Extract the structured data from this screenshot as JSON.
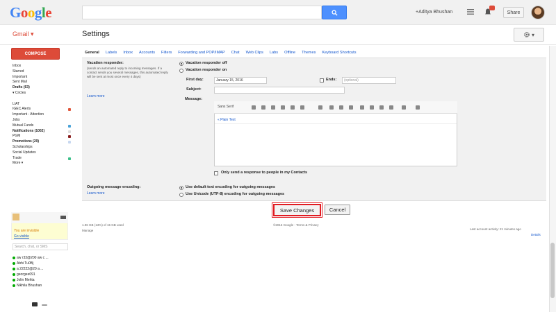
{
  "colors": {
    "brand_red": "#dd4b39",
    "link_blue": "#1155cc",
    "search_blue": "#4d90fe",
    "highlight_red": "#e11b22",
    "logo_blue": "#4285f4",
    "logo_red": "#ea4335",
    "logo_yellow": "#fbbc05",
    "logo_green": "#34a853"
  },
  "header": {
    "logo_letters": [
      "G",
      "o",
      "o",
      "g",
      "l",
      "e"
    ],
    "search_placeholder": "",
    "user_name": "+Aditya Bhushan",
    "share_label": "Share"
  },
  "subheader": {
    "app_label": "Gmail ▾",
    "page_title": "Settings"
  },
  "sidebar": {
    "compose_label": "COMPOSE",
    "items": [
      {
        "label": "Inbox",
        "bold": false
      },
      {
        "label": "Starred",
        "bold": false
      },
      {
        "label": "Important",
        "bold": false
      },
      {
        "label": "Sent Mail",
        "bold": false
      },
      {
        "label": "Drafts (63)",
        "bold": true
      },
      {
        "label": "▾ Circles",
        "bold": false
      },
      {
        "label": "",
        "bold": false
      },
      {
        "label": "LIAT",
        "bold": false
      },
      {
        "label": "IGEC Alerts",
        "bold": false,
        "dot": "#e0563a"
      },
      {
        "label": "Important - Attention",
        "bold": false
      },
      {
        "label": "Jobs",
        "bold": false
      },
      {
        "label": "Mutual Funds",
        "bold": false,
        "dot": "#4aa3d8"
      },
      {
        "label": "Notifications (1002)",
        "bold": true,
        "dot": "#dddddd"
      },
      {
        "label": "PGM",
        "bold": false,
        "dot": "#8a1f1f"
      },
      {
        "label": "Promotions (29)",
        "bold": true,
        "dot": "#c8d8f0"
      },
      {
        "label": "Scholarships",
        "bold": false
      },
      {
        "label": "Social Updates",
        "bold": false
      },
      {
        "label": "Trade",
        "bold": false,
        "dot": "#3cc08a"
      },
      {
        "label": "More ▾",
        "bold": false
      }
    ],
    "chat": {
      "user": "a ▾",
      "invisible_text": "You are invisible",
      "go_visible": "Go visible",
      "search_placeholder": "Search, chat, or SMS",
      "contacts": [
        "aw r33@200 aw c ...",
        "Abhi        Tu0Bj",
        "a 22222@20 a ...",
        "georgee091",
        "Jolin Mehta",
        "Nikhila Bhushan"
      ]
    }
  },
  "tabs": [
    {
      "label": "General",
      "active": true
    },
    {
      "label": "Labels",
      "active": false
    },
    {
      "label": "Inbox",
      "active": false
    },
    {
      "label": "Accounts",
      "active": false
    },
    {
      "label": "Filters",
      "active": false
    },
    {
      "label": "Forwarding and POP/IMAP",
      "active": false
    },
    {
      "label": "Chat",
      "active": false
    },
    {
      "label": "Web Clips",
      "active": false
    },
    {
      "label": "Labs",
      "active": false
    },
    {
      "label": "Offline",
      "active": false
    },
    {
      "label": "Themes",
      "active": false
    },
    {
      "label": "Keyboard Shortcuts",
      "active": false
    }
  ],
  "vacation": {
    "label": "Vacation responder:",
    "description": "(sends an automated reply to incoming messages. If a contact sends you several messages, this automated reply will be sent at most once every 4 days)",
    "learn_more": "Learn more",
    "off_label": "Vacation responder off",
    "on_label": "Vacation responder on",
    "first_day_label": "First day:",
    "first_day_value": "January 15, 2016",
    "ends_label": "Ends:",
    "ends_placeholder": "(optional)",
    "subject_label": "Subject:",
    "message_label": "Message:",
    "font_label": "Sans Serif",
    "plain_text": "« Plain Text",
    "contacts_only": "Only send a response to people in my Contacts"
  },
  "encoding": {
    "label": "Outgoing message encoding:",
    "learn_more": "Learn more",
    "default_option": "Use default text encoding for outgoing messages",
    "unicode_option": "Use Unicode (UTF-8) encoding for outgoing messages"
  },
  "actions": {
    "save_label": "Save Changes",
    "cancel_label": "Cancel"
  },
  "footer": {
    "storage": "1.96 GB (13%) of 15 GB used",
    "manage": "Manage",
    "copyright": "©2016 Google -  Terms & Privacy",
    "last_activity": "Last account activity: 21 minutes ago",
    "details": "Details"
  }
}
